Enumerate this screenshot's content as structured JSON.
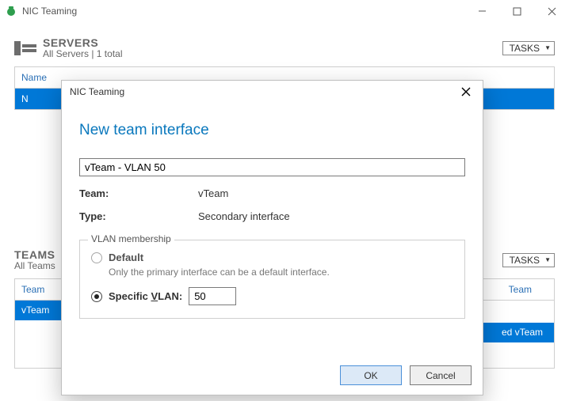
{
  "window": {
    "title": "NIC Teaming"
  },
  "servers": {
    "title": "SERVERS",
    "subtitle": "All Servers | 1 total",
    "tasks_label": "TASKS",
    "col_name": "Name",
    "row_first": "N"
  },
  "teams": {
    "title": "TEAMS",
    "subtitle": "All Teams",
    "tasks_label": "TASKS",
    "left_col": "Team",
    "left_row": "vTeam",
    "right_col": "Team",
    "right_row_suffix": "ed vTeam"
  },
  "dialog": {
    "title": "NIC Teaming",
    "heading": "New team interface",
    "name_value": "vTeam - VLAN 50",
    "team_label": "Team:",
    "team_value": "vTeam",
    "type_label": "Type:",
    "type_value": "Secondary interface",
    "group_legend": "VLAN membership",
    "default_label": "Default",
    "default_hint": "Only the primary interface can be a default interface.",
    "specific_prefix": "Specific ",
    "specific_key": "V",
    "specific_suffix": "LAN:",
    "vlan_value": "50",
    "ok": "OK",
    "cancel": "Cancel"
  }
}
